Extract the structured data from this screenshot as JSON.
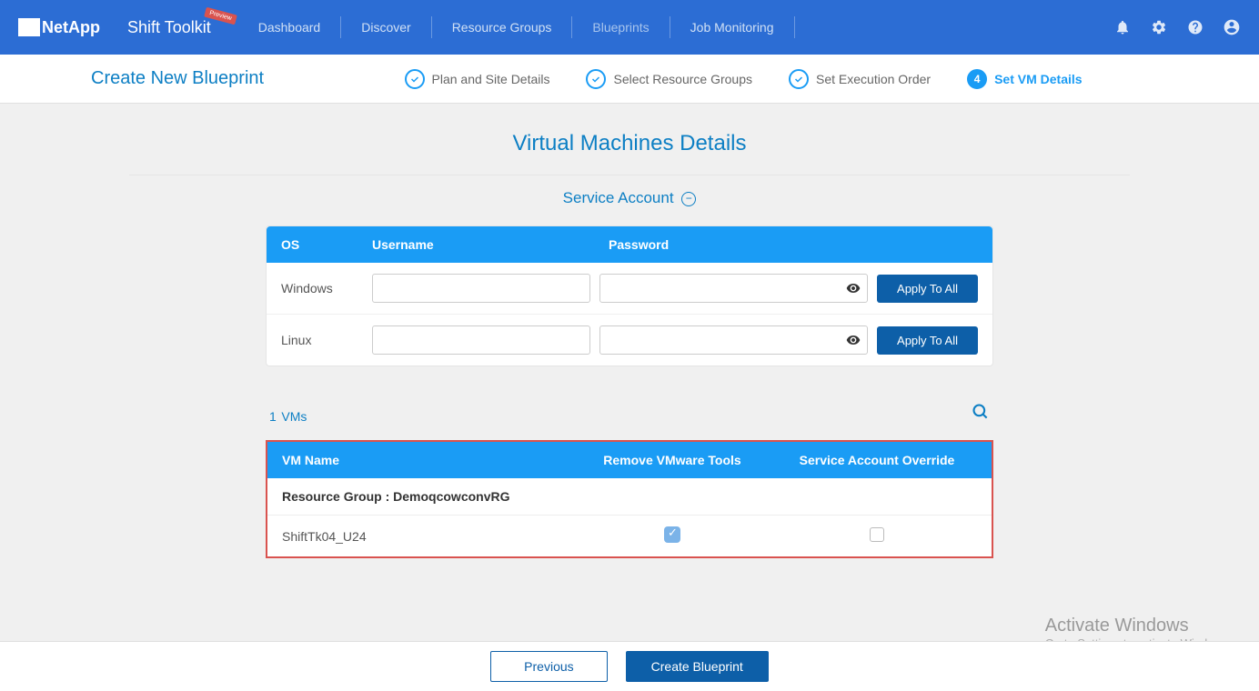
{
  "header": {
    "brand": "NetApp",
    "app_name": "Shift Toolkit",
    "preview_label": "Preview",
    "nav_items": [
      "Dashboard",
      "Discover",
      "Resource Groups",
      "Blueprints",
      "Job Monitoring"
    ],
    "nav_active_index": 3
  },
  "wizard": {
    "title": "Create New Blueprint",
    "steps": [
      {
        "label": "Plan and Site Details",
        "done": true,
        "active": false
      },
      {
        "label": "Select Resource Groups",
        "done": true,
        "active": false
      },
      {
        "label": "Set Execution Order",
        "done": true,
        "active": false
      },
      {
        "label": "Set VM Details",
        "done": false,
        "active": true,
        "num": "4"
      }
    ]
  },
  "page": {
    "title": "Virtual Machines Details",
    "service_section_title": "Service Account",
    "collapse_icon": "−"
  },
  "service_table": {
    "headers": {
      "os": "OS",
      "user": "Username",
      "pass": "Password"
    },
    "rows": [
      {
        "os": "Windows",
        "user": "",
        "pass": "",
        "apply": "Apply To All"
      },
      {
        "os": "Linux",
        "user": "",
        "pass": "",
        "apply": "Apply To All"
      }
    ]
  },
  "vms": {
    "count_num": "1",
    "count_label": "VMs",
    "headers": {
      "name": "VM Name",
      "remove": "Remove VMware Tools",
      "override": "Service Account Override"
    },
    "rg_prefix": "Resource Group : ",
    "rg_name": "DemoqcowconvRG",
    "rows": [
      {
        "name": "ShiftTk04_U24",
        "remove_checked": true,
        "override_checked": false
      }
    ]
  },
  "footer": {
    "prev": "Previous",
    "create": "Create Blueprint"
  },
  "watermark": {
    "line1": "Activate Windows",
    "line2": "Go to Settings to activate Windows."
  }
}
